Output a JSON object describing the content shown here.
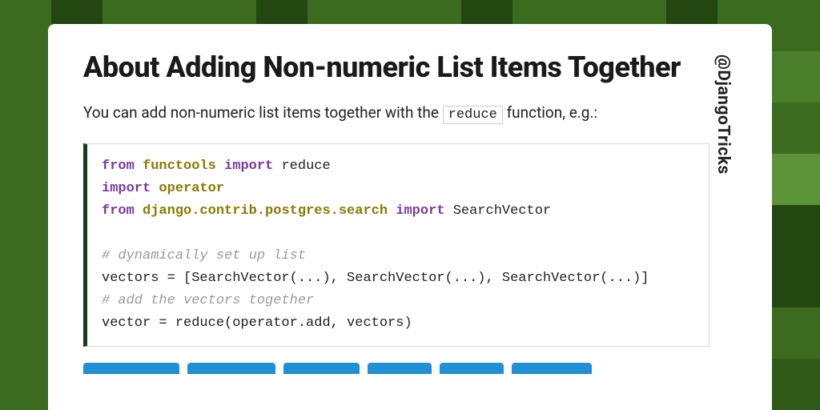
{
  "title": "About Adding Non-numeric List Items Together",
  "intro_pre": "You can add non-numeric list items together with the ",
  "intro_code": "reduce",
  "intro_post": " function, e.g.:",
  "code": {
    "l1_kw1": "from",
    "l1_mod": "functools",
    "l1_kw2": "import",
    "l1_rest": " reduce",
    "l2_kw": "import",
    "l2_mod": "operator",
    "l3_kw1": "from",
    "l3_mod": "django.contrib.postgres.search",
    "l3_kw2": "import",
    "l3_rest": " SearchVector",
    "l5_cm": "# dynamically set up list",
    "l6": "vectors = [SearchVector(...), SearchVector(...), SearchVector(...)]",
    "l7_cm": "# add the vectors together",
    "l8": "vector = reduce(operator.add, vectors)"
  },
  "handle": "@DjangoTricks"
}
